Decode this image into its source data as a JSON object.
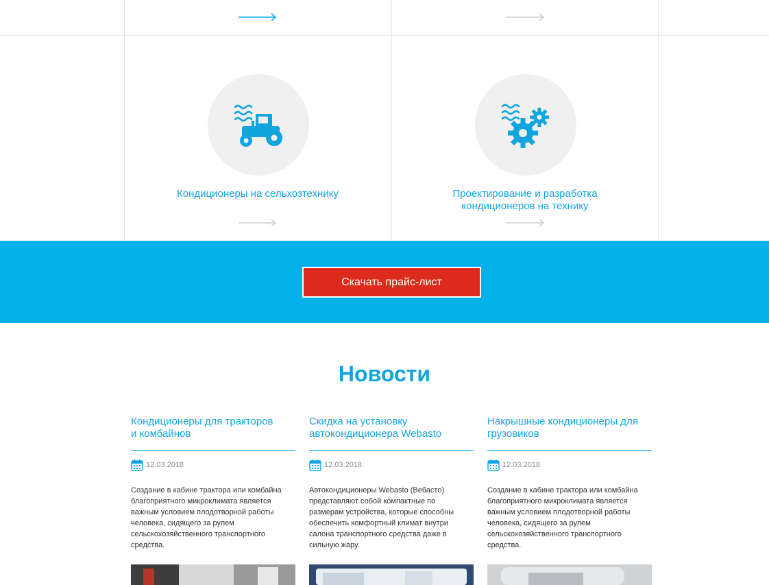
{
  "services": {
    "items": [
      {
        "title_lines": [
          "Кондиционеры на сельхозтехнику"
        ],
        "icon": "tractor-icon"
      },
      {
        "title_lines": [
          "Проектирование и разработка",
          "кондиционеров на технику"
        ],
        "icon": "gears-icon"
      }
    ],
    "colors": {
      "accent": "#11a5e0",
      "arrow_active": "#11a5e0",
      "arrow_inactive": "#cfcfcf"
    }
  },
  "banner": {
    "button_label": "Скачать прайс-лист",
    "colors": {
      "background": "#04b0ea",
      "button": "#dc2b1d"
    }
  },
  "news": {
    "heading": "Новости",
    "items": [
      {
        "title_lines": [
          "Кондиционеры для тракторов",
          "и комбайнов"
        ],
        "date": "12.03.2018",
        "text_lines": [
          "Создание в кабине трактора или комбайна",
          "благоприятного микроклимата является",
          "важным условием плодотворной работы",
          "человека, сидящего за рулем",
          "сельскохозяйственного транспортного",
          "средства."
        ]
      },
      {
        "title_lines": [
          "Скидка на установку",
          "автокондиционера Webasto"
        ],
        "date": "12.03.2018",
        "text_lines": [
          "Автокондиционеры Webasto (Вебасто)",
          "представляют собой компактные по",
          "размерам устройства, которые способны",
          "обеспечить комфортный климат внутри",
          "салона транспортного средства даже в",
          "сильную жару."
        ]
      },
      {
        "title_lines": [
          "Накрышные кондиционеры для",
          "грузовиков"
        ],
        "date": "12.03.2018",
        "text_lines": [
          "Создание в кабине трактора или комбайна",
          "благоприятного микроклимата является",
          "важным условием плодотворной работы",
          "человека, сидящего за рулем",
          "сельскохозяйственного транспортного",
          "средства."
        ]
      }
    ]
  }
}
